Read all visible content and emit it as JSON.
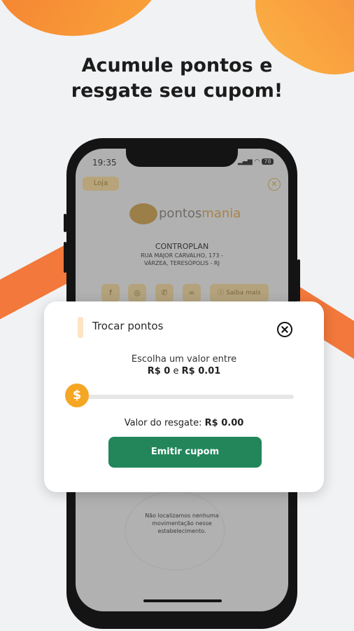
{
  "headline": {
    "line1": "Acumule pontos e",
    "line2": "resgate seu cupom!"
  },
  "status_bar": {
    "time": "19:35",
    "battery": "78"
  },
  "store": {
    "tab_label": "Loja",
    "logo_prefix": "pontos",
    "logo_suffix": "mania",
    "name": "CONTROPLAN",
    "address_line1": "RUA MAJOR CARVALHO, 173 -",
    "address_line2": "VÁRZEA, TERESÓPOLIS - RJ",
    "saiba_mais": "Saiba mais",
    "empty_line1": "Não localizamos nenhuma",
    "empty_line2": "movimentação nesse",
    "empty_line3": "estabelecimento."
  },
  "modal": {
    "title": "Trocar pontos",
    "choose_text": "Escolha um valor entre",
    "min_value": "R$ 0",
    "range_conj": "e",
    "max_value": "R$ 0.01",
    "slider_icon": "$",
    "resgate_label": "Valor do resgate:",
    "resgate_value": "R$ 0.00",
    "emit_button": "Emitir cupom"
  },
  "colors": {
    "accent_orange": "#f2783b",
    "button_green": "#22865a",
    "slider_thumb": "#f5a623"
  }
}
